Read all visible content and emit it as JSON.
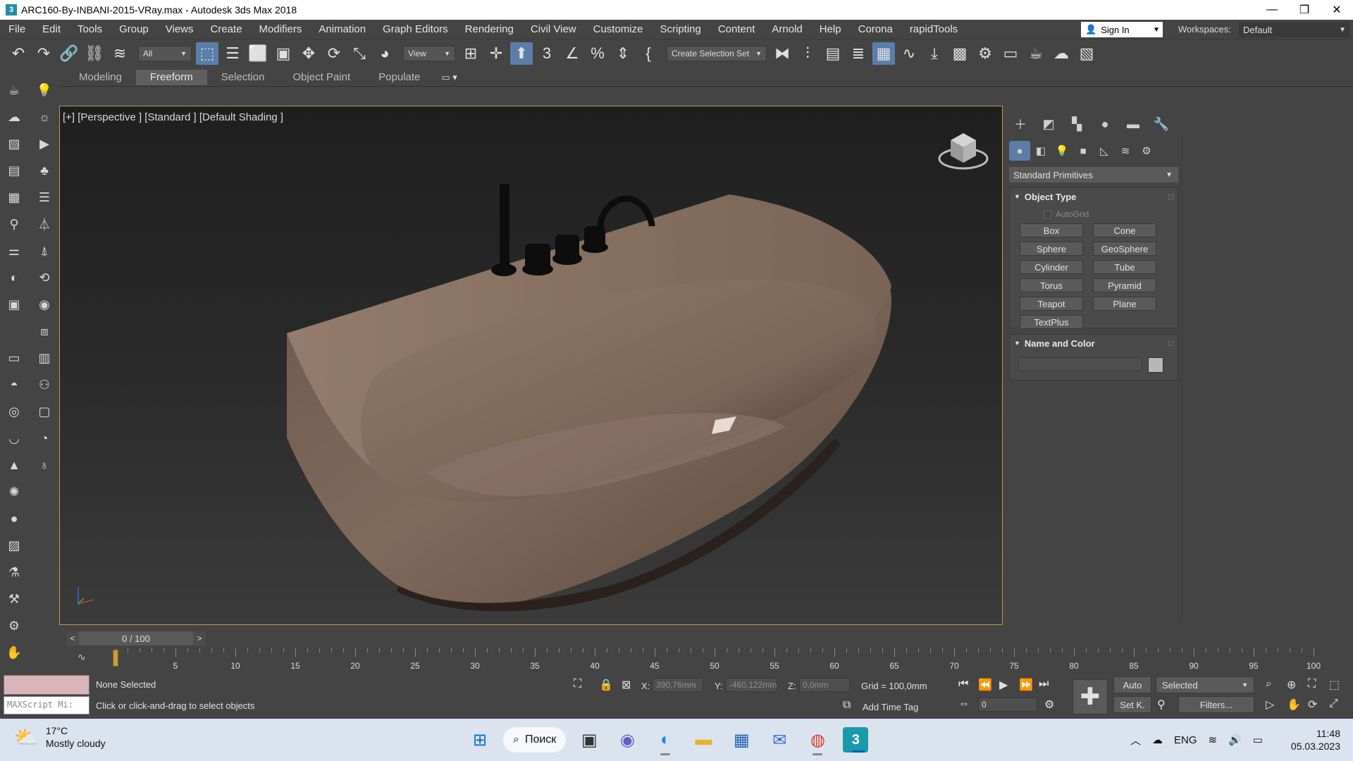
{
  "window": {
    "icon_letter": "3",
    "title": "ARC160-By-INBANI-2015-VRay.max - Autodesk 3ds Max 2018",
    "minimize": "—",
    "maximize": "❐",
    "close": "✕"
  },
  "menu": {
    "items": [
      "File",
      "Edit",
      "Tools",
      "Group",
      "Views",
      "Create",
      "Modifiers",
      "Animation",
      "Graph Editors",
      "Rendering",
      "Civil View",
      "Customize",
      "Scripting",
      "Content",
      "Arnold",
      "Help",
      "Corona",
      "rapidTools"
    ],
    "sign_in": "Sign In",
    "workspaces_label": "Workspaces:",
    "workspace_value": "Default"
  },
  "toolbar": {
    "selection_filter": "All",
    "reference_coord": "View",
    "selection_set": "Create Selection Set"
  },
  "ribbon": {
    "tabs": [
      "Modeling",
      "Freeform",
      "Selection",
      "Object Paint",
      "Populate"
    ],
    "active_tab": "Freeform"
  },
  "viewport": {
    "label": "[+] [Perspective ] [Standard ] [Default Shading ]",
    "colors": {
      "tub": "#7a6558",
      "tub_dark": "#5c4a40",
      "tub_inner": "#8c7668",
      "faucet": "#0d0d0d",
      "border_active": "#b89b4a"
    }
  },
  "command_panel": {
    "category": "Standard Primitives",
    "object_type": {
      "title": "Object Type",
      "autogrid": "AutoGrid",
      "buttons": [
        "Box",
        "Cone",
        "Sphere",
        "GeoSphere",
        "Cylinder",
        "Tube",
        "Torus",
        "Pyramid",
        "Teapot",
        "Plane",
        "TextPlus"
      ]
    },
    "name_color": {
      "title": "Name and Color",
      "swatch_color": "#b7b7b7"
    }
  },
  "timeline": {
    "frame_display": "0 / 100",
    "ticks": [
      5,
      10,
      15,
      20,
      25,
      30,
      35,
      40,
      45,
      50,
      55,
      60,
      65,
      70,
      75,
      80,
      85,
      90,
      95,
      100
    ],
    "start": 0,
    "end": 100,
    "current": 0
  },
  "status": {
    "maxscript_placeholder": "MAXScript Mi:",
    "selection": "None Selected",
    "prompt": "Click or click-and-drag to select objects",
    "x_label": "X:",
    "x_value": "390,76mm",
    "y_label": "Y:",
    "y_value": "-460,122mm",
    "z_label": "Z:",
    "z_value": "0,0mm",
    "grid": "Grid = 100,0mm",
    "add_time_tag": "Add Time Tag",
    "auto_key": "Auto",
    "set_key": "Set K.",
    "key_filter": "Selected",
    "filters": "Filters...",
    "current_frame_field": "0"
  },
  "taskbar": {
    "weather_temp": "17°C",
    "weather_desc": "Mostly cloudy",
    "search_label": "Поиск",
    "language": "ENG",
    "time": "11:48",
    "date": "05.03.2023"
  }
}
